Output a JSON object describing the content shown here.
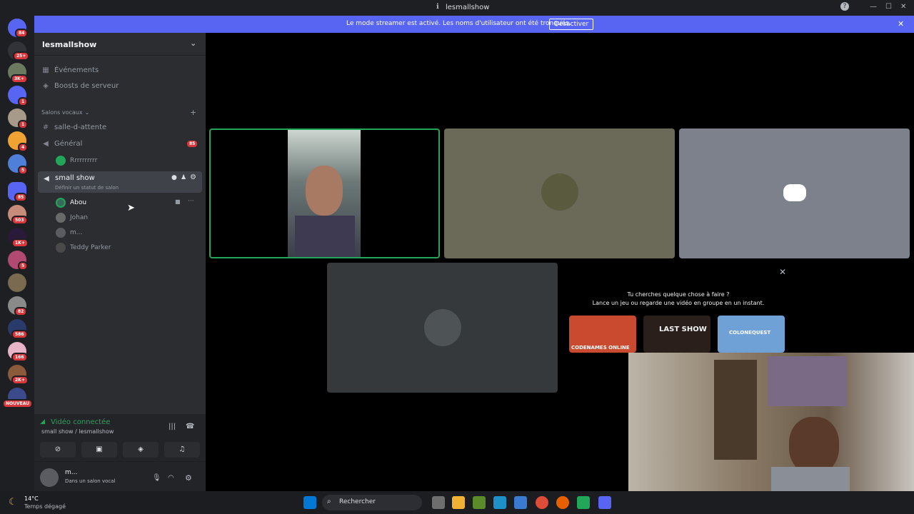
{
  "window": {
    "title": "lesmallshow",
    "info_icon": "ℹ",
    "help_icon": "?",
    "min_icon": "—",
    "max_icon": "☐",
    "close_icon": "✕"
  },
  "banner": {
    "message": "Le mode streamer est activé. Les noms d'utilisateur ont été tronqués.",
    "button": "Désactiver"
  },
  "rail": {
    "badges": [
      "84",
      "25+",
      "3K+",
      "1",
      "1",
      "4",
      "5",
      "85",
      "503",
      "1K+",
      "5",
      "82",
      "586",
      "166",
      "2K+"
    ],
    "new_label": "NOUVEAU"
  },
  "server": {
    "name": "lesmallshow",
    "events": "Événements",
    "boosts": "Boosts de serveur",
    "category": "Salons vocaux",
    "channels": {
      "waiting": "salle-d-attente",
      "general": "Général",
      "general_badge": "85",
      "general_user": "Rrrrrrrrrr",
      "small_show": "small show",
      "status_hint": "Définir un statut de salon"
    },
    "members": [
      {
        "name": "Abou"
      },
      {
        "name": "Johan"
      },
      {
        "name": "m..."
      },
      {
        "name": "Teddy Parker"
      }
    ]
  },
  "voice": {
    "status": "Vidéo connectée",
    "location": "small show / lesmallshow"
  },
  "user": {
    "name": "m...",
    "status": "Dans un salon vocal"
  },
  "activity": {
    "title": "Tu cherches quelque chose à faire ?",
    "subtitle": "Lance un jeu ou regarde une vidéo en groupe en un instant.",
    "games": [
      {
        "label": "CODENAMES ONLINE",
        "color": "#c94a2f"
      },
      {
        "label": "LAST SHOW",
        "color": "#2a1f1a"
      },
      {
        "label": "COLONEQUEST",
        "color": "#6fa0d6"
      }
    ]
  },
  "taskbar": {
    "weather_temp": "14°C",
    "weather_desc": "Temps dégagé",
    "search": "Rechercher"
  },
  "colors": {
    "accent": "#5865f2",
    "speaking": "#23a55a",
    "badge": "#da373c",
    "tile_olive": "#6b6a58",
    "tile_slate": "#7d818b",
    "tile_dark": "#35393b"
  }
}
